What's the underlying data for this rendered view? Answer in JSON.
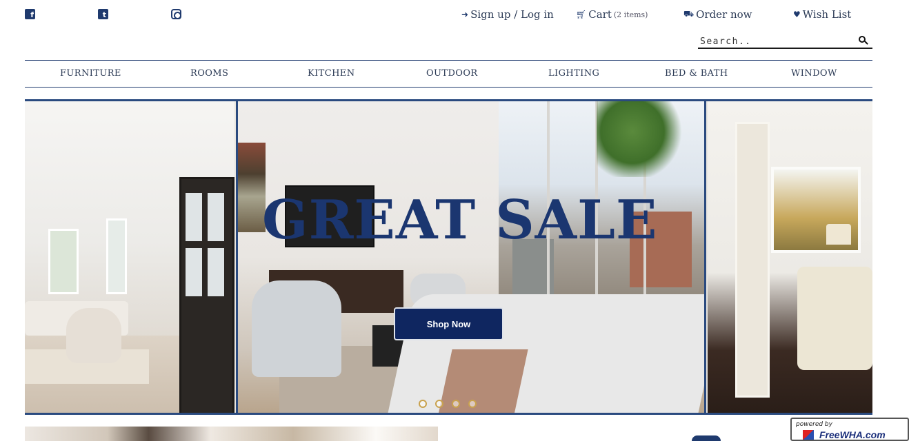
{
  "social": {
    "facebook_icon": "facebook-icon",
    "twitter_icon": "twitter-icon",
    "instagram_icon": "instagram-icon"
  },
  "header": {
    "signup_label": "Sign up / Log in",
    "cart_label": "Cart",
    "cart_count": "(2 items)",
    "order_label": "Order now",
    "wishlist_label": "Wish List"
  },
  "search": {
    "placeholder": "Search.."
  },
  "nav": {
    "items": [
      "FURNITURE",
      "ROOMS",
      "KITCHEN",
      "OUTDOOR",
      "LIGHTING",
      "BED & BATH",
      "WINDOW"
    ]
  },
  "hero": {
    "headline": "GREAT SALE",
    "cta_label": "Shop Now",
    "slide_count": 4
  },
  "badge": {
    "powered_by": "powered by",
    "brand": "FreeWHA.com"
  },
  "colors": {
    "brand_navy": "#1b3670",
    "cta_bg": "#0f2660",
    "accent_gold": "#c9a24e"
  }
}
